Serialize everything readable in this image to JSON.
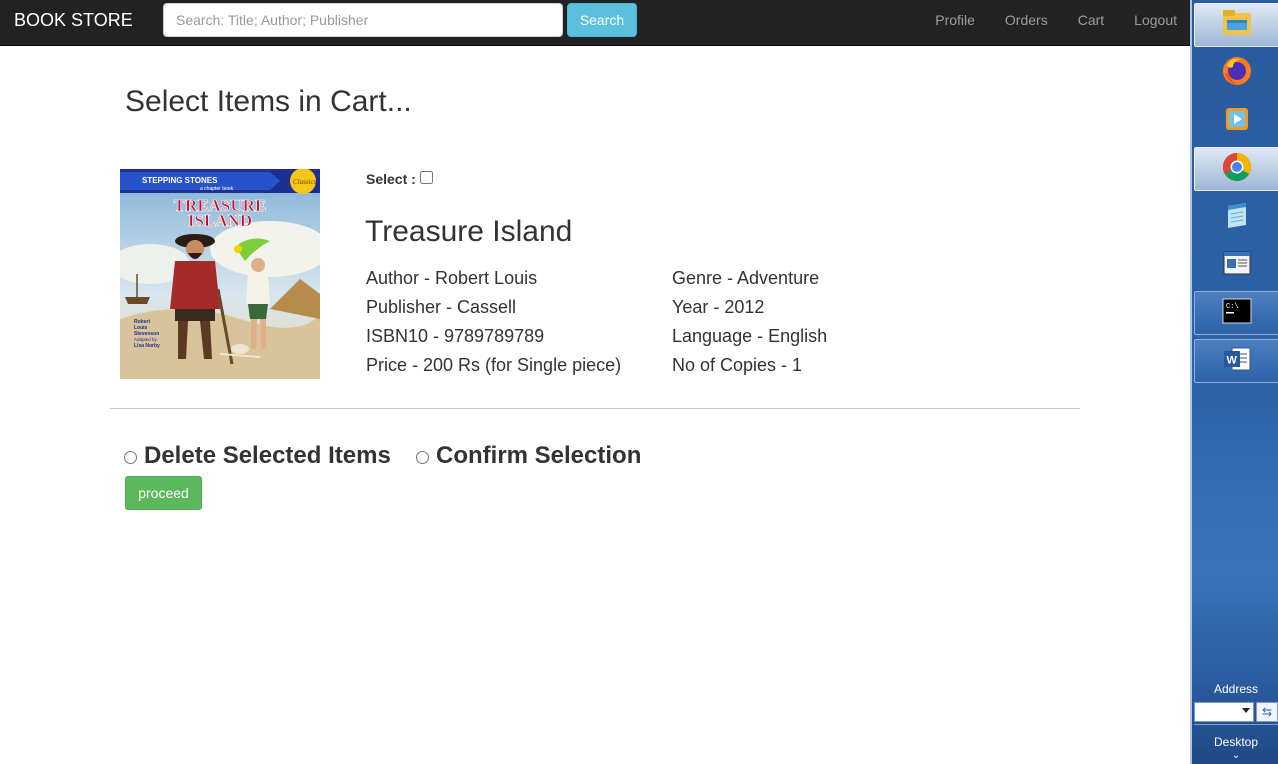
{
  "navbar": {
    "brand": "BOOK STORE",
    "search_placeholder": "Search: Title; Author; Publisher",
    "search_button": "Search",
    "links": [
      "Profile",
      "Orders",
      "Cart",
      "Logout"
    ]
  },
  "page": {
    "title": "Select Items in Cart..."
  },
  "cart_item": {
    "select_label": "Select :",
    "selected": false,
    "title": "Treasure Island",
    "author": "Author - Robert Louis",
    "publisher": "Publisher - Cassell",
    "isbn": "ISBN10 - 9789789789",
    "price": "Price - 200 Rs (for Single piece)",
    "genre": "Genre - Adventure",
    "year": "Year - 2012",
    "language": "Language - English",
    "copies": "No of Copies - 1",
    "cover": {
      "series": "STEPPING STONES",
      "series_sub": "a chapter book",
      "badge": "Classics",
      "title_line1": "TREASURE",
      "title_line2": "ISLAND",
      "author_lines": [
        "Robert",
        "Louis",
        "Stevenson"
      ],
      "adapted": "Adapted by",
      "adapter": "Lisa Norby"
    }
  },
  "actions": {
    "delete_label": "Delete Selected Items",
    "confirm_label": "Confirm Selection",
    "proceed_label": "proceed"
  },
  "taskbar": {
    "address_label": "Address",
    "desktop_label": "Desktop",
    "apps": [
      "file-explorer-icon",
      "firefox-icon",
      "media-player-icon",
      "chrome-icon",
      "notepad-icon",
      "window-app-icon",
      "command-prompt-icon",
      "word-icon"
    ]
  }
}
